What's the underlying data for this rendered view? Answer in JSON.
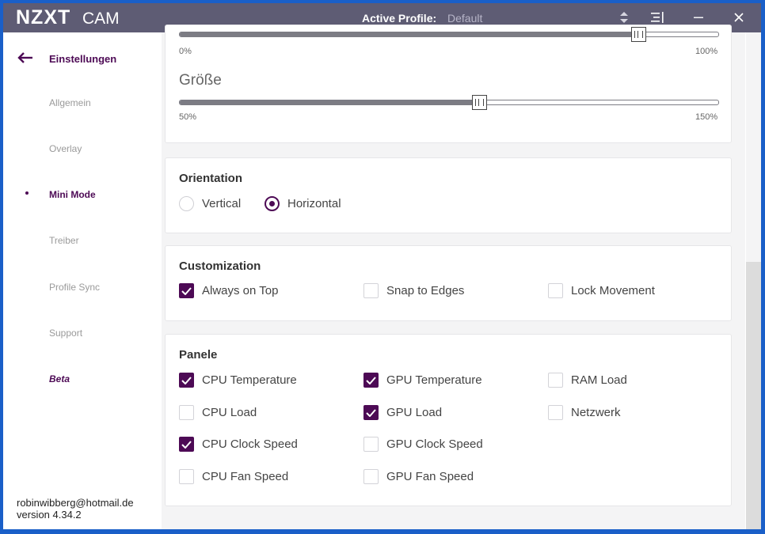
{
  "titlebar": {
    "brand": "NZXT",
    "product": "CAM",
    "profile_label": "Active Profile:",
    "profile_value": "Default",
    "icons": [
      "profile-switch-icon",
      "menu-collapse-icon",
      "minimize-icon",
      "close-icon"
    ]
  },
  "sidebar": {
    "back_label": "Einstellungen",
    "items": [
      {
        "label": "Allgemein"
      },
      {
        "label": "Overlay"
      },
      {
        "label": "Mini Mode",
        "active": true
      },
      {
        "label": "Treiber"
      },
      {
        "label": "Profile Sync"
      },
      {
        "label": "Support"
      },
      {
        "label": "Beta"
      }
    ],
    "footer": {
      "email": "robinwibberg@hotmail.de",
      "version": "version 4.34.2"
    }
  },
  "sliders": {
    "opacity": {
      "min_label": "0%",
      "max_label": "100%",
      "value_fraction": 0.853
    },
    "size": {
      "name": "Größe",
      "min_label": "50%",
      "max_label": "150%",
      "value_fraction": 0.557
    }
  },
  "orientation": {
    "title": "Orientation",
    "options": [
      {
        "label": "Vertical",
        "checked": false
      },
      {
        "label": "Horizontal",
        "checked": true
      }
    ]
  },
  "customization": {
    "title": "Customization",
    "options": [
      {
        "label": "Always on Top",
        "checked": true
      },
      {
        "label": "Snap to Edges",
        "checked": false
      },
      {
        "label": "Lock Movement",
        "checked": false
      }
    ]
  },
  "panels": {
    "title": "Panele",
    "options": [
      {
        "label": "CPU Temperature",
        "checked": true
      },
      {
        "label": "GPU Temperature",
        "checked": true
      },
      {
        "label": "RAM Load",
        "checked": false
      },
      {
        "label": "CPU Load",
        "checked": false
      },
      {
        "label": "GPU Load",
        "checked": true
      },
      {
        "label": "Netzwerk",
        "checked": false
      },
      {
        "label": "CPU Clock Speed",
        "checked": true
      },
      {
        "label": "GPU Clock Speed",
        "checked": false
      },
      {
        "label": "CPU Fan Speed",
        "checked": false
      },
      {
        "label": "GPU Fan Speed",
        "checked": false
      }
    ]
  },
  "colors": {
    "accent": "#4d0a55",
    "titlebar": "#5e5c74",
    "desktop": "#1a5fc8"
  }
}
